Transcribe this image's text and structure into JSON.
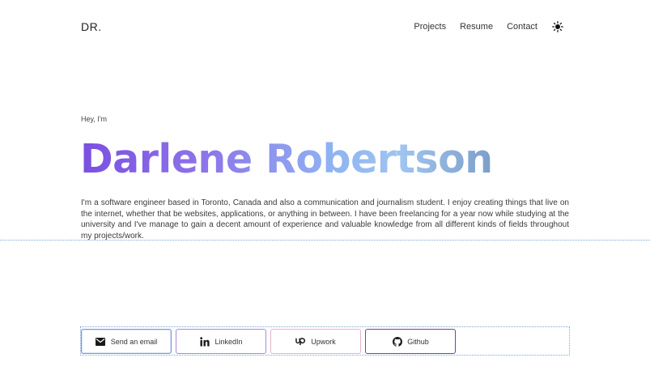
{
  "header": {
    "logo": "DR.",
    "nav": [
      {
        "label": "Projects"
      },
      {
        "label": "Resume"
      },
      {
        "label": "Contact"
      }
    ],
    "theme_toggle_icon": "sun-icon"
  },
  "hero": {
    "greeting": "Hey, I'm",
    "name": "Darlene Robertson",
    "name_gradient_colors": [
      "#7b4fe0",
      "#8fb5f2",
      "#7c9ec8"
    ],
    "bio": "I'm a software engineer based in Toronto, Canada and also a communication and journalism student. I enjoy creating things that live on the internet, whether that be websites, applications, or anything in between. I have been freelancing for a year now while studying at the university and I've manage to gain a decent amount of experience and valuable knowledge from all different kinds of fields throughout my projects/work."
  },
  "links": [
    {
      "label": "Send an email",
      "icon": "mail-icon"
    },
    {
      "label": "LinkedIn",
      "icon": "linkedin-icon"
    },
    {
      "label": "Upwork",
      "icon": "upwork-icon"
    },
    {
      "label": "Github",
      "icon": "github-icon"
    }
  ]
}
